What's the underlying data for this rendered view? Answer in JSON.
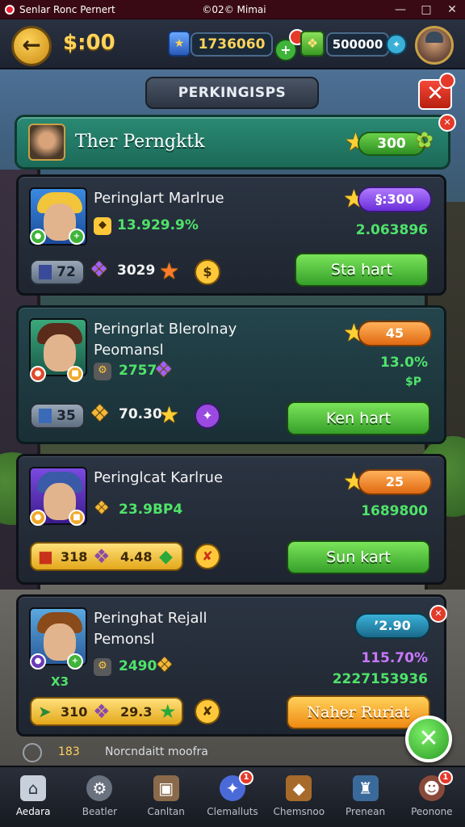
{
  "titlebar": {
    "app_name": "Senlar Ronc Pernert",
    "center_title": "©02© Mimai",
    "minimize": "—",
    "maximize": "□",
    "close": "✕"
  },
  "topbar": {
    "back_icon": "arrow-left-icon",
    "coins": "$:00",
    "resource_a": "1736060",
    "resource_b": "500000"
  },
  "section_pill": "PERKINGISPS",
  "header_card": {
    "title": "Ther Perngktk",
    "reward": "300",
    "close_badge": "✕"
  },
  "cards": [
    {
      "title_line1": "Peringlart Marlrue",
      "title_line2": "",
      "stat_primary": "13.929.9%",
      "reward": "§:300",
      "stat_right_1": "2.063896",
      "stat_right_2": "",
      "counter": "72",
      "bottom_value": "3029",
      "button": "Sta hart"
    },
    {
      "title_line1": "Peringrlat Blerolnay",
      "title_line2": "Peomansl",
      "stat_primary": "2757",
      "reward": "45",
      "stat_right_1": "13.0%",
      "stat_right_2": "$P",
      "counter": "35",
      "bottom_value": "70.30",
      "button": "Ken hart"
    },
    {
      "title_line1": "Peringlcat Karlrue",
      "title_line2": "",
      "stat_primary": "23.9BP4",
      "reward": "25",
      "stat_right_1": "1689800",
      "stat_right_2": "",
      "strip_a": "318",
      "strip_b": "4.48",
      "button": "Sun kart"
    },
    {
      "title_line1": "Peringhat Rejall",
      "title_line2": "Pemonsl",
      "stat_primary": "2490",
      "reward": "’2.90",
      "stat_right_1": "115.70%",
      "stat_right_2": "2227153936",
      "side_mark": "X3",
      "strip_a": "310",
      "strip_b": "29.3",
      "button": "Naher Ruriat"
    }
  ],
  "bottom_info": {
    "count": "183",
    "text": "Norcndaitt moofra"
  },
  "fab_icon": "close-icon",
  "nav": [
    {
      "label": "Aedara",
      "icon": "home-icon",
      "badge": ""
    },
    {
      "label": "Beatler",
      "icon": "robot-icon",
      "badge": ""
    },
    {
      "label": "Canltan",
      "icon": "crate-icon",
      "badge": ""
    },
    {
      "label": "Clemalluts",
      "icon": "compass-icon",
      "badge": "1"
    },
    {
      "label": "Chemsnoo",
      "icon": "chest-icon",
      "badge": ""
    },
    {
      "label": "Prenean",
      "icon": "castle-icon",
      "badge": ""
    },
    {
      "label": "Peonone",
      "icon": "hero-icon",
      "badge": "1"
    }
  ]
}
